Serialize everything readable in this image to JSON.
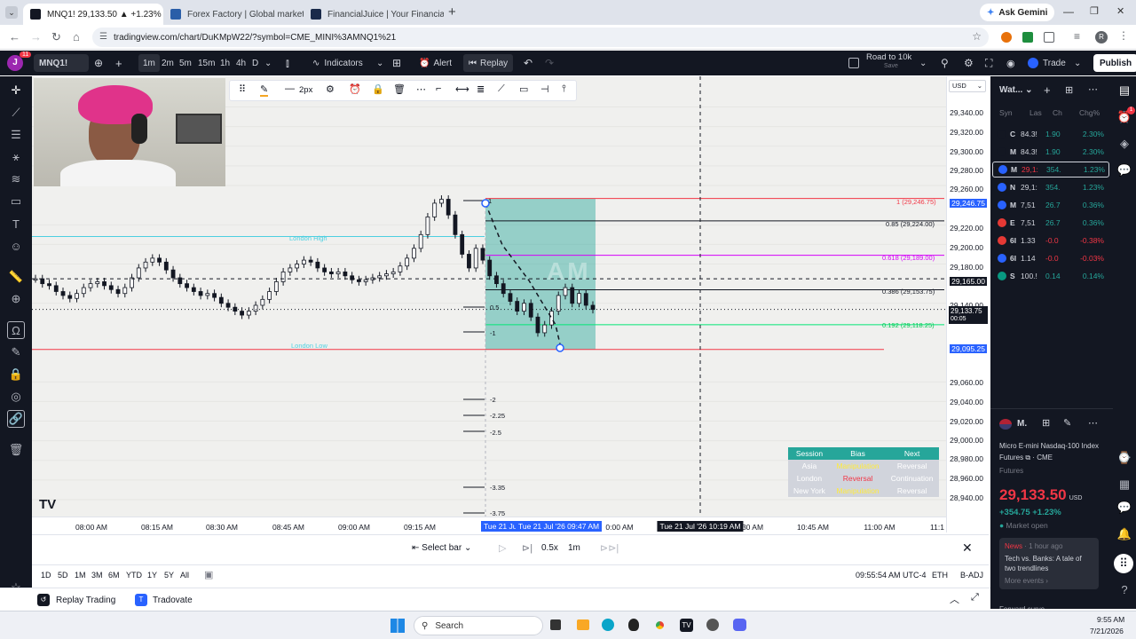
{
  "browser": {
    "tabs": [
      {
        "label": "MNQ1! 29,133.50 ▲ +1.23% Re",
        "active": true,
        "color": "#131722"
      },
      {
        "label": "Forex Factory | Global markets f",
        "active": false,
        "color": "#2a5ea8"
      },
      {
        "label": "FinancialJuice | Your Financial L",
        "active": false,
        "color": "#1a2a4a"
      }
    ],
    "new_tab": "+",
    "gemini": "Ask Gemini",
    "url": "tradingview.com/chart/DuKMpW22/?symbol=CME_MINI%3AMNQ1%21"
  },
  "tv_toolbar": {
    "symbol": "MNQ1!",
    "intervals": [
      "1m",
      "2m",
      "5m",
      "15m",
      "1h",
      "4h",
      "D"
    ],
    "indicators": "Indicators",
    "alert": "Alert",
    "replay": "Replay",
    "layout_name": "Road to 10k",
    "layout_sub": "Save",
    "trade": "Trade",
    "publish": "Publish",
    "avatar_letter": "J",
    "badge": "11"
  },
  "drawing_toolbar": {
    "width_label": "2px"
  },
  "price_scale": {
    "currency": "USD",
    "ticks": [
      "29,340.00",
      "29,320.00",
      "29,300.00",
      "29,280.00",
      "29,260.00",
      "29,220.00",
      "29,200.00",
      "29,180.00",
      "29,140.00",
      "29,060.00",
      "29,040.00",
      "29,020.00",
      "29,000.00",
      "28,980.00",
      "28,960.00",
      "28,940.00"
    ],
    "tag_246": "29,246.75",
    "tag_cross": "29,165.00",
    "tag_last": "29,133.75",
    "tag_last_timer": "00:05",
    "tag_low": "29,095.25"
  },
  "fib": {
    "lvl_1": "1 (29,246.75)",
    "lvl_085": "0.85 (29,224.00)",
    "lvl_0618": "0.618 (29,189.00)",
    "lvl_0386": "0.386 (29,153.75)",
    "lvl_0192": "0.192 (29,118.25)",
    "ext": [
      "1",
      "0.5",
      "-1",
      "-2",
      "-2.25",
      "-2.5",
      "-3.35",
      "-3.75"
    ]
  },
  "chart_labels": {
    "london_high": "London High",
    "london_low": "London Low",
    "box_label": "AM"
  },
  "session_table": {
    "headers": [
      "Session",
      "Bias",
      "Next"
    ],
    "rows": [
      [
        "Asia",
        "Manipulation",
        "Reversal"
      ],
      [
        "London",
        "Reversal",
        "Continuation"
      ],
      [
        "New York",
        "Manipulation",
        "Reversal"
      ]
    ]
  },
  "time_scale": {
    "ticks": [
      "08:00 AM",
      "08:15 AM",
      "08:30 AM",
      "08:45 AM",
      "09:00 AM",
      "09:15 AM",
      "0:00 AM",
      "30 AM",
      "10:45 AM",
      "11:00 AM",
      "11:1"
    ],
    "range_start": "Tue 21 Jul '26   09:30",
    "range_end": "Tue 21 Jul '26   09:47 AM",
    "cursor": "Tue 21 Jul '26   10:19 AM"
  },
  "replay_bar": {
    "select_bar": "Select bar",
    "speed": "0.5x",
    "interval": "1m"
  },
  "range_bar": {
    "ranges": [
      "1D",
      "5D",
      "1M",
      "3M",
      "6M",
      "YTD",
      "1Y",
      "5Y",
      "All"
    ],
    "clock": "09:55:54 AM UTC-4",
    "session": "ETH",
    "adj": "B-ADJ"
  },
  "bottom_tabs": {
    "replay_trading": "Replay Trading",
    "tradovate": "Tradovate"
  },
  "watchlist": {
    "title": "Wat...",
    "headers": [
      "Syn",
      "Las",
      "Ch",
      "Chg%"
    ],
    "rows": [
      {
        "sym": "C",
        "last": "84.3!",
        "ch": "1.90",
        "chp": "2.30%",
        "pos": true,
        "color": "#131722"
      },
      {
        "sym": "M",
        "last": "84.3!",
        "ch": "1.90",
        "chp": "2.30%",
        "pos": true,
        "color": "#131722"
      },
      {
        "sym": "M",
        "last": "29,1:",
        "ch": "354.",
        "chp": "1.23%",
        "pos": true,
        "sel": true,
        "color": "#2962ff"
      },
      {
        "sym": "N",
        "last": "29,1:",
        "ch": "354.",
        "chp": "1.23%",
        "pos": true,
        "color": "#2962ff"
      },
      {
        "sym": "M",
        "last": "7,51",
        "ch": "26.7",
        "chp": "0.36%",
        "pos": true,
        "color": "#2962ff"
      },
      {
        "sym": "E",
        "last": "7,51",
        "ch": "26.7",
        "chp": "0.36%",
        "pos": true,
        "color": "#e53935"
      },
      {
        "sym": "6I",
        "last": "1.33",
        "ch": "-0.0",
        "chp": "-0.38%",
        "pos": false,
        "color": "#e53935"
      },
      {
        "sym": "6I",
        "last": "1.14",
        "ch": "-0.0",
        "chp": "-0.03%",
        "pos": false,
        "color": "#2962ff"
      },
      {
        "sym": "S",
        "last": "100.!",
        "ch": "0.14",
        "chp": "0.14%",
        "pos": true,
        "color": "#089981"
      }
    ]
  },
  "details": {
    "short": "M.",
    "name": "Micro E-mini Nasdaq-100 Index Futures",
    "exchange": "CME",
    "type": "Futures",
    "price": "29,133.50",
    "currency": "USD",
    "change": "+354.75 +1.23%",
    "status": "Market open",
    "news_tag": "News",
    "news_time": "1 hour ago",
    "news_title": "Tech vs. Banks: A tale of two trendlines",
    "more_events": "More events",
    "forward": "Forward curve"
  },
  "taskbar": {
    "search": "Search",
    "time": "9:55 AM",
    "date": "7/21/2026"
  },
  "chart_data": {
    "type": "candlestick",
    "timeframe": "1m",
    "symbol": "MNQ1!",
    "x_ticks": [
      "08:00 AM",
      "08:15 AM",
      "08:30 AM",
      "08:45 AM",
      "09:00 AM",
      "09:15 AM",
      "0:00 AM",
      "30 AM",
      "10:45 AM",
      "11:00 AM"
    ],
    "y_range": [
      28930,
      29345
    ],
    "y_ticks": [
      29340,
      29320,
      29300,
      29280,
      29260,
      29220,
      29200,
      29180,
      29140,
      29060,
      29040,
      29020,
      29000,
      28980,
      28960,
      28940
    ],
    "levels": [
      {
        "label": "1 (29,246.75)",
        "value": 29246.75,
        "color": "#f23645"
      },
      {
        "label": "0.85 (29,224.00)",
        "value": 29224.0,
        "color": "#131722"
      },
      {
        "label": "0.618 (29,189.00)",
        "value": 29189.0,
        "color": "#d500f9"
      },
      {
        "label": "0.386 (29,153.75)",
        "value": 29153.75,
        "color": "#131722"
      },
      {
        "label": "0.192 (29,118.25)",
        "value": 29118.25,
        "color": "#00e676"
      }
    ],
    "london_high": 29208,
    "london_low": 29093,
    "last_price": 29133.75,
    "closes": [
      29165,
      29160,
      29158,
      29152,
      29148,
      29145,
      29150,
      29156,
      29160,
      29162,
      29158,
      29154,
      29150,
      29156,
      29166,
      29176,
      29182,
      29186,
      29182,
      29174,
      29166,
      29160,
      29156,
      29152,
      29148,
      29150,
      29146,
      29140,
      29136,
      29132,
      29128,
      29132,
      29138,
      29144,
      29152,
      29162,
      29172,
      29176,
      29180,
      29184,
      29182,
      29176,
      29172,
      29170,
      29172,
      29168,
      29164,
      29162,
      29164,
      29166,
      29168,
      29170,
      29172,
      29178,
      29186,
      29196,
      29210,
      29228,
      29242,
      29246,
      29230,
      29210,
      29190,
      29176,
      29196,
      29184,
      29168,
      29160,
      29150,
      29142,
      29132,
      29140,
      29126,
      29110,
      29118,
      29132,
      29148,
      29156,
      29140,
      29150,
      29138,
      29133.75
    ]
  }
}
